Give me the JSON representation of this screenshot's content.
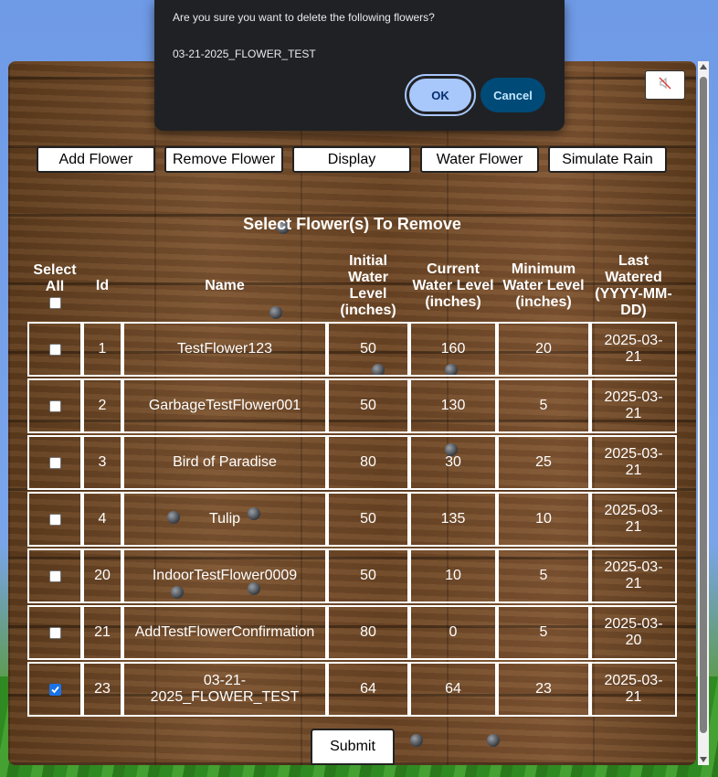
{
  "dialog": {
    "message": "Are you sure you want to delete the following flowers?",
    "item": "03-21-2025_FLOWER_TEST",
    "ok_label": "OK",
    "cancel_label": "Cancel"
  },
  "nav": {
    "add": "Add Flower",
    "remove": "Remove Flower",
    "display": "Display",
    "water": "Water Flower",
    "rain": "Simulate Rain"
  },
  "mute_icon": "muted-speaker-icon",
  "section_title": "Select Flower(s) To Remove",
  "table": {
    "headers": {
      "select": [
        "Select",
        "All"
      ],
      "id": "Id",
      "name": "Name",
      "initial": [
        "Initial",
        "Water",
        "Level",
        "(inches)"
      ],
      "current": [
        "Current",
        "Water Level",
        "(inches)"
      ],
      "minimum": [
        "Minimum",
        "Water Level",
        "(inches)"
      ],
      "last": [
        "Last",
        "Watered",
        "(YYYY-MM-",
        "DD)"
      ]
    },
    "select_all_checked": false,
    "rows": [
      {
        "checked": false,
        "id": "1",
        "name": "TestFlower123",
        "initial": "50",
        "current": "160",
        "minimum": "20",
        "last": [
          "2025-03-",
          "21"
        ]
      },
      {
        "checked": false,
        "id": "2",
        "name": "GarbageTestFlower001",
        "initial": "50",
        "current": "130",
        "minimum": "5",
        "last": [
          "2025-03-",
          "21"
        ]
      },
      {
        "checked": false,
        "id": "3",
        "name": "Bird of Paradise",
        "initial": "80",
        "current": "30",
        "minimum": "25",
        "last": [
          "2025-03-",
          "21"
        ]
      },
      {
        "checked": false,
        "id": "4",
        "name": "Tulip",
        "initial": "50",
        "current": "135",
        "minimum": "10",
        "last": [
          "2025-03-",
          "21"
        ]
      },
      {
        "checked": false,
        "id": "20",
        "name": "IndoorTestFlower0009",
        "initial": "50",
        "current": "10",
        "minimum": "5",
        "last": [
          "2025-03-",
          "21"
        ]
      },
      {
        "checked": false,
        "id": "21",
        "name": "AddTestFlowerConfirmation",
        "initial": "80",
        "current": "0",
        "minimum": "5",
        "last": [
          "2025-03-",
          "20"
        ]
      },
      {
        "checked": true,
        "id": "23",
        "name": "03-21-2025_FLOWER_TEST",
        "name_lines": [
          "03-21-",
          "2025_FLOWER_TEST"
        ],
        "initial": "64",
        "current": "64",
        "minimum": "23",
        "last": [
          "2025-03-",
          "21"
        ]
      }
    ]
  },
  "submit_label": "Submit"
}
